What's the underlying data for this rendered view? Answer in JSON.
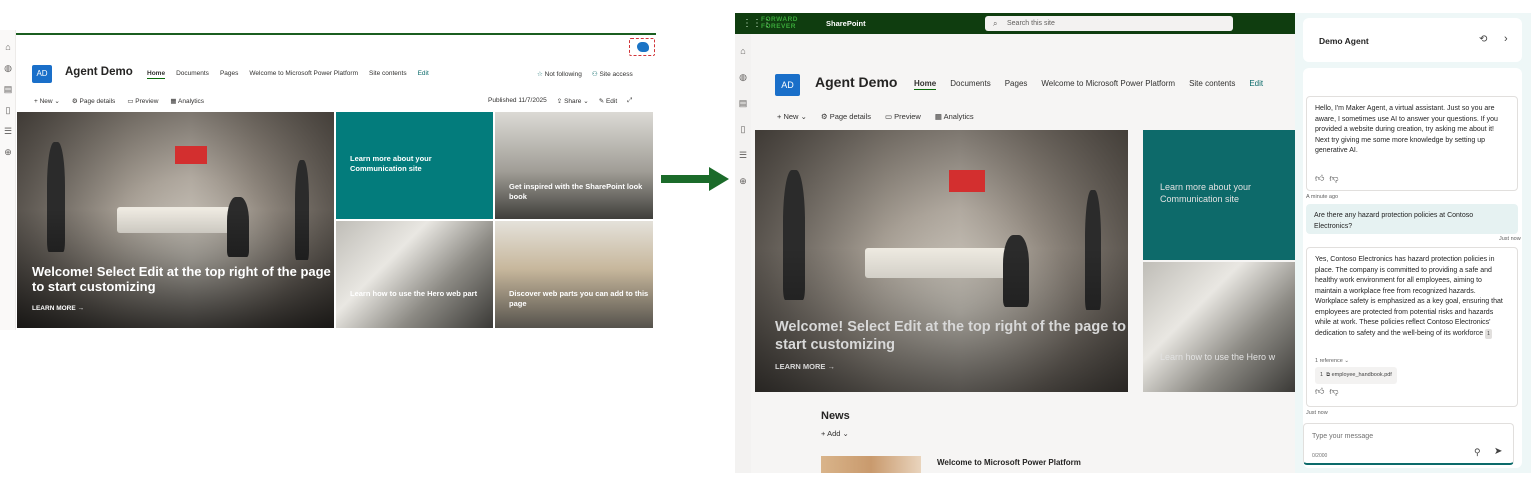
{
  "left_window": {
    "site": {
      "logo": "AD",
      "title": "Agent Demo"
    },
    "nav": {
      "items": [
        "Home",
        "Documents",
        "Pages",
        "Welcome to Microsoft Power Platform",
        "Site contents"
      ],
      "edit": "Edit"
    },
    "follow": {
      "not_following": "Not following",
      "site_access": "Site access"
    },
    "commandbar": {
      "new": "New",
      "page_details": "Page details",
      "preview": "Preview",
      "analytics": "Analytics",
      "published": "Published 11/7/2025",
      "share": "Share",
      "edit": "Edit"
    },
    "hero": {
      "main_title": "Welcome! Select Edit at the top right of the page to start customizing",
      "learn_more": "LEARN MORE →",
      "tiles": [
        "Learn more about your Communication site",
        "Get inspired with the SharePoint look book",
        "Learn how to use the Hero web part",
        "Discover web parts you can add to this page"
      ]
    },
    "icons": {
      "copilot": "copilot-icon",
      "rail": [
        "home-icon",
        "globe-icon",
        "news-icon",
        "file-icon",
        "list-icon",
        "add-icon"
      ]
    }
  },
  "right_window": {
    "suite": {
      "brand_line1": "FORWARD",
      "brand_line2": "FOREVER",
      "app": "SharePoint",
      "search_placeholder": "Search this site"
    },
    "site": {
      "logo": "AD",
      "title": "Agent Demo"
    },
    "nav": {
      "items": [
        "Home",
        "Documents",
        "Pages",
        "Welcome to Microsoft Power Platform",
        "Site contents"
      ],
      "edit": "Edit"
    },
    "commandbar": {
      "new": "New",
      "page_details": "Page details",
      "preview": "Preview",
      "analytics": "Analytics"
    },
    "hero": {
      "main_title": "Welcome! Select Edit at the top right of the page to start customizing",
      "learn_more": "LEARN MORE →",
      "tile_teal": "Learn more about your Communication site",
      "tile_bottom": "Learn how to use the Hero w"
    },
    "news": {
      "title": "News",
      "add": "Add",
      "item_title": "Welcome to Microsoft Power Platform"
    }
  },
  "chat": {
    "title": "Demo Agent",
    "messages": [
      {
        "role": "agent",
        "text": "Hello, I'm Maker Agent, a virtual assistant. Just so you are aware, I sometimes use AI to answer your questions. If you provided a website during creation, try asking me about it! Next try giving me some more knowledge by setting up generative AI.",
        "time": "A minute ago"
      },
      {
        "role": "user",
        "text": "Are there any hazard protection policies at Contoso Electronics?",
        "time": "Just now"
      },
      {
        "role": "agent",
        "text": "Yes, Contoso Electronics has hazard protection policies in place. The company is committed to providing a safe and healthy work environment for all employees, aiming to maintain a workplace free from recognized hazards. Workplace safety is emphasized as a key goal, ensuring that employees are protected from potential risks and hazards while at work. These policies reflect Contoso Electronics' dedication to safety and the well-being of its workforce",
        "citation": "1",
        "reference_count": "1 reference",
        "reference_index": "1",
        "reference_file": "employee_handbook.pdf",
        "time": "Just now"
      }
    ],
    "input": {
      "placeholder": "Type your message",
      "counter": "0/2000"
    }
  },
  "colors": {
    "teal": "#037c7c",
    "suite_green": "#0f3d0f",
    "arrow_green": "#1b6b2a",
    "site_logo_blue": "#1a6fc9",
    "copilot_outline": "#d13438"
  }
}
